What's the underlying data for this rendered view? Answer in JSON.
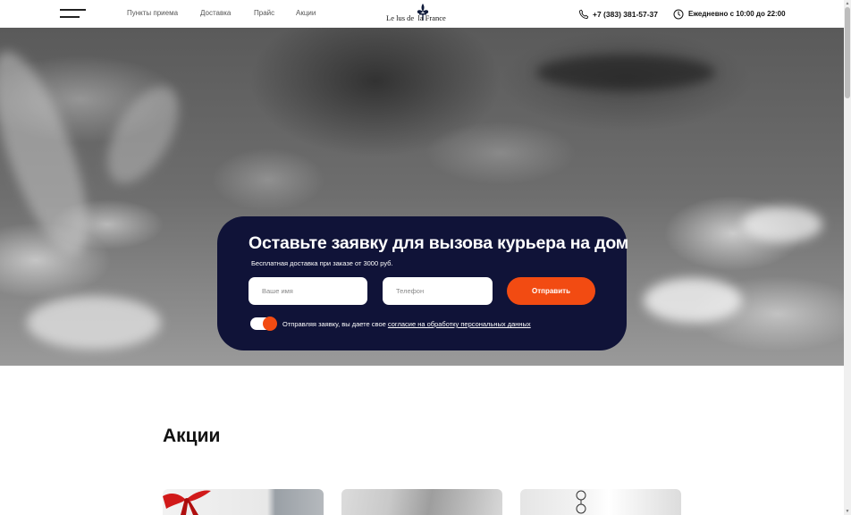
{
  "header": {
    "nav": [
      {
        "label": "Пункты приема"
      },
      {
        "label": "Доставка"
      },
      {
        "label": "Прайс"
      },
      {
        "label": "Акции"
      }
    ],
    "logo_text": "Le lus de  la France",
    "phone": "+7 (383) 381-57-37",
    "hours": "Ежедневно с 10:00 до 22:00"
  },
  "hero": {
    "title": "Оставьте заявку для вызова курьера на дом",
    "subtitle": "Бесплатная доставка при заказе от 3000 руб.",
    "name_placeholder": "Ваше имя",
    "phone_placeholder": "Телефон",
    "submit_label": "Отправить",
    "consent_text": "Отправляя заявку, вы даете свое ",
    "consent_link": "согласие на обработку персональных данных",
    "consent_toggle_on": true
  },
  "promotions": {
    "title": "Акции"
  },
  "colors": {
    "accent": "#f24b12",
    "card_bg": "#101338"
  }
}
